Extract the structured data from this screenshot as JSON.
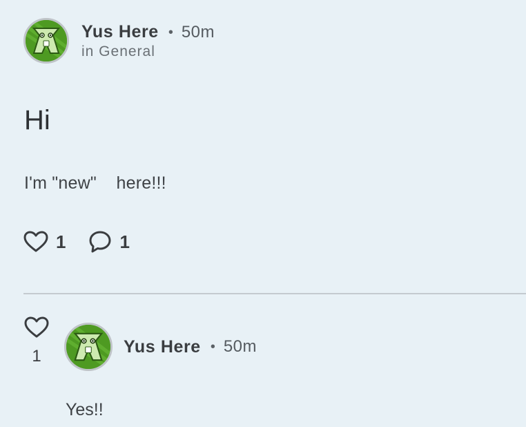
{
  "post": {
    "author": "Yus Here",
    "separator": "•",
    "time": "50m",
    "category": "in General",
    "avatar_icon": "green-character-avatar",
    "title": "Hi",
    "body": "I'm \"new\"    here!!!",
    "likes": "1",
    "comments": "1",
    "like_icon": "heart-icon",
    "comment_icon": "speech-bubble-icon"
  },
  "comment": {
    "author": "Yus Here",
    "separator": "•",
    "time": "50m",
    "avatar_icon": "green-character-avatar",
    "likes": "1",
    "like_icon": "heart-icon",
    "body": "Yes!!"
  },
  "colors": {
    "background": "#e8f1f6",
    "text": "#2f3336",
    "divider": "#c4cacf",
    "avatar_green": "#5aa42c"
  }
}
